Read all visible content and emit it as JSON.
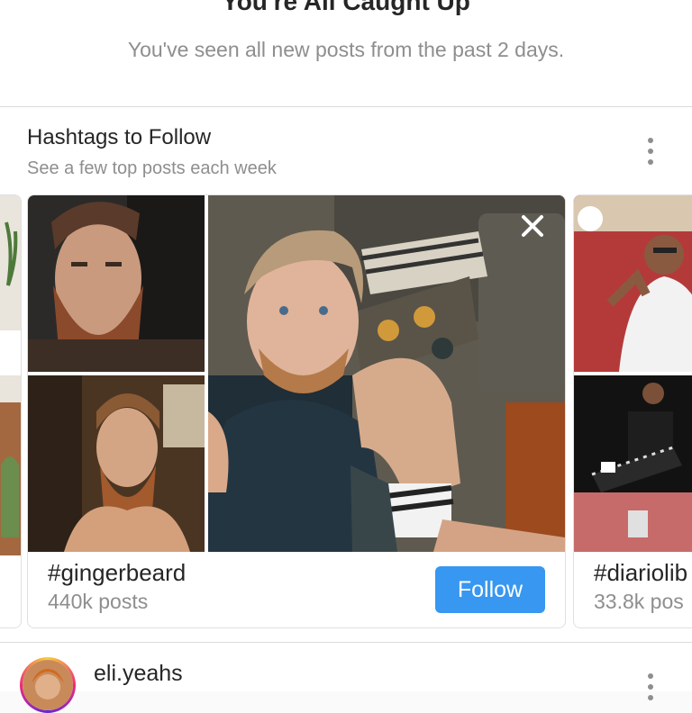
{
  "caught_up": {
    "title": "You're All Caught Up",
    "subtitle": "You've seen all new posts from the past 2 days."
  },
  "hashtags_section": {
    "title": "Hashtags to Follow",
    "subtitle": "See a few top posts each week",
    "more_icon": "more-vertical-icon",
    "cards": [
      {
        "tag": "#gingerbeard",
        "count": "440k posts",
        "follow_label": "Follow",
        "close_icon": "close-icon"
      },
      {
        "tag": "#diariolib",
        "count": "33.8k pos"
      }
    ]
  },
  "post": {
    "username": "eli.yeahs",
    "more_icon": "more-vertical-icon"
  },
  "colors": {
    "accent": "#3897f0",
    "text": "#262626",
    "secondary_text": "#8e8e8e",
    "divider": "#dbdbdb",
    "background": "#fafafa"
  }
}
